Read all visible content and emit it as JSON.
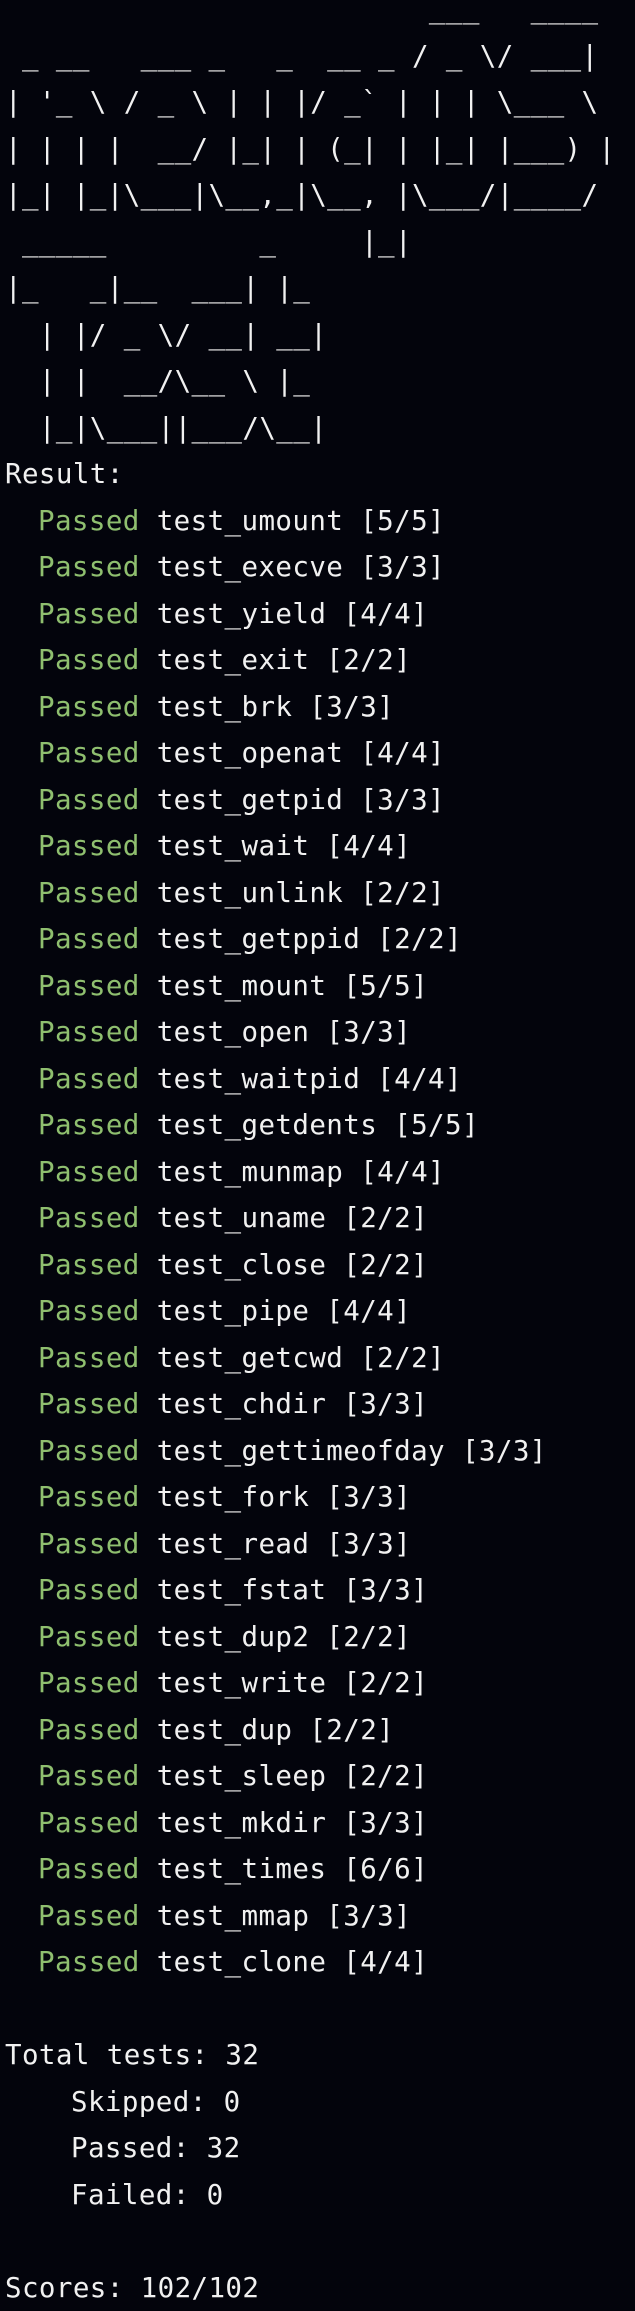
{
  "banner": {
    "lines": [
      "                         ___   ____ ",
      " _ __   ___ _   _  __ _ / _ \\/ ___|",
      "| '_ \\ / _ \\ | | |/ _` | | | \\___ \\",
      "| | | |  __/ |_| | (_| | |_| |___) |",
      "|_| |_|\\___|\\__,_|\\__, |\\___/|____/",
      " _____         _     |_|",
      "|_   _|__  ___| |_",
      "  | |/ _ \\/ __| __|",
      "  | |  __/\\__ \\ |_",
      "  |_|\\___||___/\\__|"
    ]
  },
  "result_label": "Result:",
  "tests": [
    {
      "status": "Passed",
      "name": "test_umount",
      "score": "[5/5]"
    },
    {
      "status": "Passed",
      "name": "test_execve",
      "score": "[3/3]"
    },
    {
      "status": "Passed",
      "name": "test_yield",
      "score": "[4/4]"
    },
    {
      "status": "Passed",
      "name": "test_exit",
      "score": "[2/2]"
    },
    {
      "status": "Passed",
      "name": "test_brk",
      "score": "[3/3]"
    },
    {
      "status": "Passed",
      "name": "test_openat",
      "score": "[4/4]"
    },
    {
      "status": "Passed",
      "name": "test_getpid",
      "score": "[3/3]"
    },
    {
      "status": "Passed",
      "name": "test_wait",
      "score": "[4/4]"
    },
    {
      "status": "Passed",
      "name": "test_unlink",
      "score": "[2/2]"
    },
    {
      "status": "Passed",
      "name": "test_getppid",
      "score": "[2/2]"
    },
    {
      "status": "Passed",
      "name": "test_mount",
      "score": "[5/5]"
    },
    {
      "status": "Passed",
      "name": "test_open",
      "score": "[3/3]"
    },
    {
      "status": "Passed",
      "name": "test_waitpid",
      "score": "[4/4]"
    },
    {
      "status": "Passed",
      "name": "test_getdents",
      "score": "[5/5]"
    },
    {
      "status": "Passed",
      "name": "test_munmap",
      "score": "[4/4]"
    },
    {
      "status": "Passed",
      "name": "test_uname",
      "score": "[2/2]"
    },
    {
      "status": "Passed",
      "name": "test_close",
      "score": "[2/2]"
    },
    {
      "status": "Passed",
      "name": "test_pipe",
      "score": "[4/4]"
    },
    {
      "status": "Passed",
      "name": "test_getcwd",
      "score": "[2/2]"
    },
    {
      "status": "Passed",
      "name": "test_chdir",
      "score": "[3/3]"
    },
    {
      "status": "Passed",
      "name": "test_gettimeofday",
      "score": "[3/3]"
    },
    {
      "status": "Passed",
      "name": "test_fork",
      "score": "[3/3]"
    },
    {
      "status": "Passed",
      "name": "test_read",
      "score": "[3/3]"
    },
    {
      "status": "Passed",
      "name": "test_fstat",
      "score": "[3/3]"
    },
    {
      "status": "Passed",
      "name": "test_dup2",
      "score": "[2/2]"
    },
    {
      "status": "Passed",
      "name": "test_write",
      "score": "[2/2]"
    },
    {
      "status": "Passed",
      "name": "test_dup",
      "score": "[2/2]"
    },
    {
      "status": "Passed",
      "name": "test_sleep",
      "score": "[2/2]"
    },
    {
      "status": "Passed",
      "name": "test_mkdir",
      "score": "[3/3]"
    },
    {
      "status": "Passed",
      "name": "test_times",
      "score": "[6/6]"
    },
    {
      "status": "Passed",
      "name": "test_mmap",
      "score": "[3/3]"
    },
    {
      "status": "Passed",
      "name": "test_clone",
      "score": "[4/4]"
    }
  ],
  "summary": {
    "total": "Total tests: 32",
    "skipped": "Skipped: 0",
    "passed": "Passed: 32",
    "failed": "Failed: 0"
  },
  "scores": "Scores: 102/102",
  "colors": {
    "background": "#03040c",
    "text": "#f1f1f1",
    "passed": "#8fbf6f"
  }
}
